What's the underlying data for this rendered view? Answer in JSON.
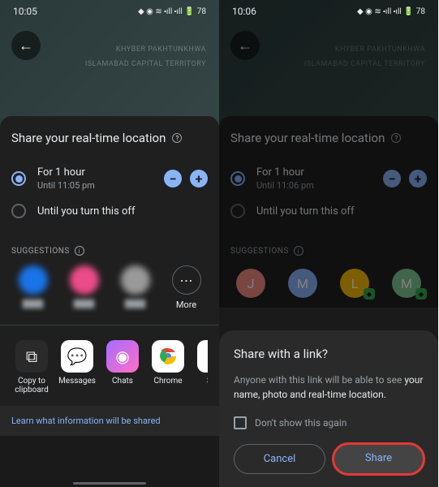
{
  "left": {
    "statusbar": {
      "time": "10:05",
      "battery": "78"
    },
    "map": {
      "label1": "KHYBER PAKHTUNKHWA",
      "label2": "ISLAMABAD CAPITAL TERRITORY"
    },
    "sheet_title": "Share your real-time location",
    "options": [
      {
        "label": "For 1 hour",
        "sub": "Until 11:05 pm",
        "checked": true
      },
      {
        "label": "Until you turn this off",
        "sub": "",
        "checked": false
      }
    ],
    "suggestions_label": "SUGGESTIONS",
    "more_label": "More",
    "apps": [
      {
        "label": "Copy to\nclipboard",
        "bg": "#2a2a2a",
        "glyph": "⧉"
      },
      {
        "label": "Messages",
        "bg": "#fff",
        "glyph": "💬"
      },
      {
        "label": "Chats",
        "bg": "#fff",
        "glyph": "◉"
      },
      {
        "label": "Chrome",
        "bg": "#fff",
        "glyph": "●"
      },
      {
        "label": "Sav",
        "bg": "#fff",
        "glyph": ""
      }
    ],
    "learn": "Learn what information will be shared"
  },
  "right": {
    "statusbar": {
      "time": "10:06",
      "battery": "78"
    },
    "sheet_title": "Share your real-time location",
    "options": [
      {
        "label": "For 1 hour",
        "sub": "Until 11:06 pm",
        "checked": true
      },
      {
        "label": "Until you turn this off",
        "sub": "",
        "checked": false
      }
    ],
    "suggestions_label": "SUGGESTIONS",
    "contacts": [
      {
        "letter": "J",
        "color": "#f28b82"
      },
      {
        "letter": "M",
        "color": "#8ab4f8"
      },
      {
        "letter": "L",
        "color": "#fbbc04"
      },
      {
        "letter": "M",
        "color": "#81c995"
      }
    ],
    "dialog": {
      "title": "Share with a link?",
      "body_pre": "Anyone with this link will be able to see ",
      "body_hl": "your name, photo and real-time location.",
      "dont_show": "Don't show this again",
      "cancel": "Cancel",
      "share": "Share"
    }
  }
}
